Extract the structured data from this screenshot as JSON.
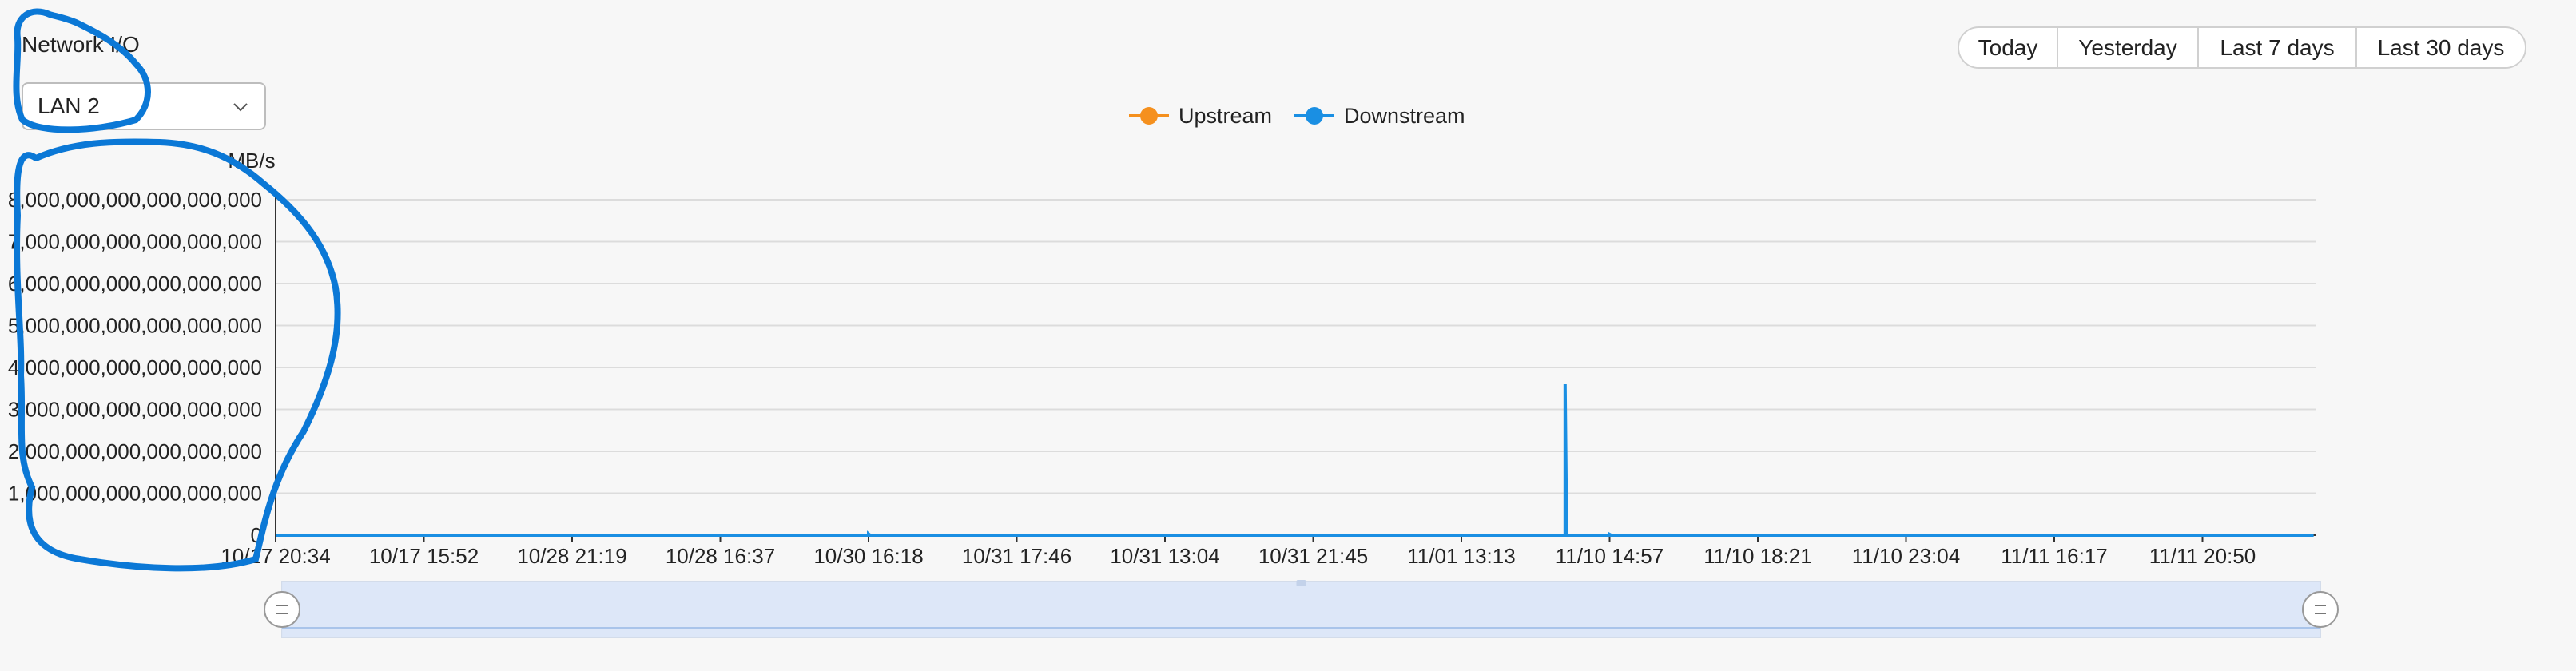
{
  "panel": {
    "title": "Network I/O",
    "interface_select": {
      "value": "LAN 2"
    }
  },
  "time_range": {
    "options": [
      {
        "label": "Today"
      },
      {
        "label": "Yesterday"
      },
      {
        "label": "Last 7 days"
      },
      {
        "label": "Last 30 days"
      }
    ],
    "selected": "Last 30 days",
    "active_color": "#1a8fe3"
  },
  "chart_data": {
    "type": "line",
    "title": "",
    "xlabel": "",
    "ylabel": "MB/s",
    "ylim": [
      0,
      8000000000000000000
    ],
    "grid": true,
    "legend_placement": "top-center",
    "yticks": [
      "0",
      "1,000,000,000,000,000,000",
      "2,000,000,000,000,000,000",
      "3,000,000,000,000,000,000",
      "4,000,000,000,000,000,000",
      "5,000,000,000,000,000,000",
      "6,000,000,000,000,000,000",
      "7,000,000,000,000,000,000",
      "8,000,000,000,000,000,000"
    ],
    "categories": [
      "10/17 20:34",
      "10/17 15:52",
      "10/28 21:19",
      "10/28 16:37",
      "10/30 16:18",
      "10/31 17:46",
      "10/31 13:04",
      "10/31 21:45",
      "11/01 13:13",
      "11/10 14:57",
      "11/10 18:21",
      "11/10 23:04",
      "11/11 16:17",
      "11/11 20:50"
    ],
    "series": [
      {
        "name": "Upstream",
        "color": "#f5901e",
        "points": [
          {
            "x": 0,
            "y": 0
          },
          {
            "x": 13.75,
            "y": 0
          }
        ]
      },
      {
        "name": "Downstream",
        "color": "#1a8fe3",
        "points": [
          {
            "x": 0,
            "y": 0
          },
          {
            "x": 4.0,
            "y": 0
          },
          {
            "x": 4.0,
            "y": 30000000000000000
          },
          {
            "x": 4.01,
            "y": 0
          },
          {
            "x": 8.7,
            "y": 0
          },
          {
            "x": 8.7,
            "y": 3600000000000000000
          },
          {
            "x": 8.71,
            "y": 0
          },
          {
            "x": 9.0,
            "y": 0
          },
          {
            "x": 9.0,
            "y": 20000000000000000
          },
          {
            "x": 9.01,
            "y": 0
          },
          {
            "x": 13.75,
            "y": 0
          }
        ]
      }
    ],
    "zoom": {
      "start_percent": 0,
      "end_percent": 100
    }
  }
}
